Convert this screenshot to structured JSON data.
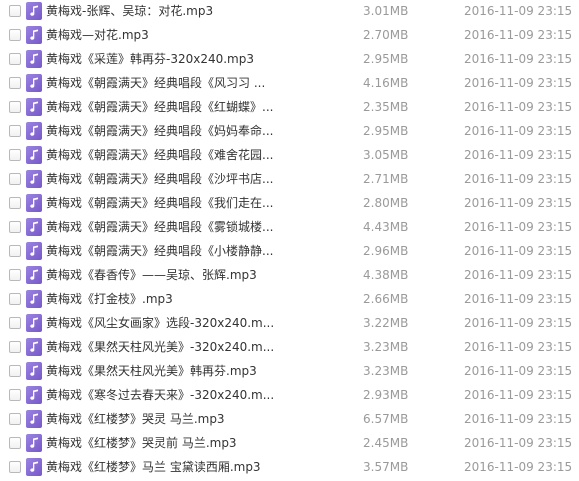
{
  "icon": "music-file-icon",
  "colors": {
    "icon_bg": "#8469d6",
    "name_text": "#333333",
    "meta_text": "#9a9a9a"
  },
  "files": [
    {
      "name": "黄梅戏-张辉、吴琼：对花.mp3",
      "size": "3.01MB",
      "date": "2016-11-09 23:15"
    },
    {
      "name": "黄梅戏—对花.mp3",
      "size": "2.70MB",
      "date": "2016-11-09 23:15"
    },
    {
      "name": "黄梅戏《采莲》韩再芬-320x240.mp3",
      "size": "2.95MB",
      "date": "2016-11-09 23:15"
    },
    {
      "name": "黄梅戏《朝霞满天》经典唱段《风习习 ...",
      "size": "4.16MB",
      "date": "2016-11-09 23:15"
    },
    {
      "name": "黄梅戏《朝霞满天》经典唱段《红蝴蝶》...",
      "size": "2.35MB",
      "date": "2016-11-09 23:15"
    },
    {
      "name": "黄梅戏《朝霞满天》经典唱段《妈妈奉命...",
      "size": "2.95MB",
      "date": "2016-11-09 23:15"
    },
    {
      "name": "黄梅戏《朝霞满天》经典唱段《难舍花园...",
      "size": "3.05MB",
      "date": "2016-11-09 23:15"
    },
    {
      "name": "黄梅戏《朝霞满天》经典唱段《沙坪书店...",
      "size": "2.71MB",
      "date": "2016-11-09 23:15"
    },
    {
      "name": "黄梅戏《朝霞满天》经典唱段《我们走在...",
      "size": "2.80MB",
      "date": "2016-11-09 23:15"
    },
    {
      "name": "黄梅戏《朝霞满天》经典唱段《雾锁城楼...",
      "size": "4.43MB",
      "date": "2016-11-09 23:15"
    },
    {
      "name": "黄梅戏《朝霞满天》经典唱段《小楼静静...",
      "size": "2.96MB",
      "date": "2016-11-09 23:15"
    },
    {
      "name": "黄梅戏《春香传》——吴琼、张辉.mp3",
      "size": "4.38MB",
      "date": "2016-11-09 23:15"
    },
    {
      "name": "黄梅戏《打金枝》.mp3",
      "size": "2.66MB",
      "date": "2016-11-09 23:15"
    },
    {
      "name": "黄梅戏《风尘女画家》选段-320x240.m...",
      "size": "3.22MB",
      "date": "2016-11-09 23:15"
    },
    {
      "name": "黄梅戏《果然天柱风光美》-320x240.m...",
      "size": "3.23MB",
      "date": "2016-11-09 23:15"
    },
    {
      "name": "黄梅戏《果然天柱风光美》韩再芬.mp3",
      "size": "3.23MB",
      "date": "2016-11-09 23:15"
    },
    {
      "name": "黄梅戏《寒冬过去春天来》-320x240.m...",
      "size": "2.93MB",
      "date": "2016-11-09 23:15"
    },
    {
      "name": "黄梅戏《红楼梦》哭灵 马兰.mp3",
      "size": "6.57MB",
      "date": "2016-11-09 23:15"
    },
    {
      "name": "黄梅戏《红楼梦》哭灵前 马兰.mp3",
      "size": "2.45MB",
      "date": "2016-11-09 23:15"
    },
    {
      "name": "黄梅戏《红楼梦》马兰 宝黛读西厢.mp3",
      "size": "3.57MB",
      "date": "2016-11-09 23:15"
    }
  ]
}
